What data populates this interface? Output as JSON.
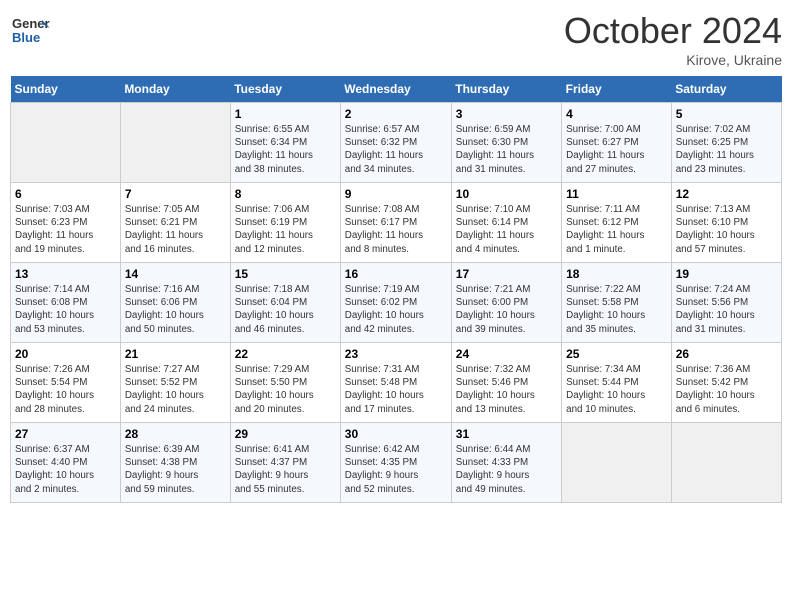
{
  "header": {
    "logo_general": "General",
    "logo_blue": "Blue",
    "month": "October 2024",
    "location": "Kirove, Ukraine"
  },
  "weekdays": [
    "Sunday",
    "Monday",
    "Tuesday",
    "Wednesday",
    "Thursday",
    "Friday",
    "Saturday"
  ],
  "weeks": [
    [
      {
        "day": "",
        "info": ""
      },
      {
        "day": "",
        "info": ""
      },
      {
        "day": "1",
        "info": "Sunrise: 6:55 AM\nSunset: 6:34 PM\nDaylight: 11 hours\nand 38 minutes."
      },
      {
        "day": "2",
        "info": "Sunrise: 6:57 AM\nSunset: 6:32 PM\nDaylight: 11 hours\nand 34 minutes."
      },
      {
        "day": "3",
        "info": "Sunrise: 6:59 AM\nSunset: 6:30 PM\nDaylight: 11 hours\nand 31 minutes."
      },
      {
        "day": "4",
        "info": "Sunrise: 7:00 AM\nSunset: 6:27 PM\nDaylight: 11 hours\nand 27 minutes."
      },
      {
        "day": "5",
        "info": "Sunrise: 7:02 AM\nSunset: 6:25 PM\nDaylight: 11 hours\nand 23 minutes."
      }
    ],
    [
      {
        "day": "6",
        "info": "Sunrise: 7:03 AM\nSunset: 6:23 PM\nDaylight: 11 hours\nand 19 minutes."
      },
      {
        "day": "7",
        "info": "Sunrise: 7:05 AM\nSunset: 6:21 PM\nDaylight: 11 hours\nand 16 minutes."
      },
      {
        "day": "8",
        "info": "Sunrise: 7:06 AM\nSunset: 6:19 PM\nDaylight: 11 hours\nand 12 minutes."
      },
      {
        "day": "9",
        "info": "Sunrise: 7:08 AM\nSunset: 6:17 PM\nDaylight: 11 hours\nand 8 minutes."
      },
      {
        "day": "10",
        "info": "Sunrise: 7:10 AM\nSunset: 6:14 PM\nDaylight: 11 hours\nand 4 minutes."
      },
      {
        "day": "11",
        "info": "Sunrise: 7:11 AM\nSunset: 6:12 PM\nDaylight: 11 hours\nand 1 minute."
      },
      {
        "day": "12",
        "info": "Sunrise: 7:13 AM\nSunset: 6:10 PM\nDaylight: 10 hours\nand 57 minutes."
      }
    ],
    [
      {
        "day": "13",
        "info": "Sunrise: 7:14 AM\nSunset: 6:08 PM\nDaylight: 10 hours\nand 53 minutes."
      },
      {
        "day": "14",
        "info": "Sunrise: 7:16 AM\nSunset: 6:06 PM\nDaylight: 10 hours\nand 50 minutes."
      },
      {
        "day": "15",
        "info": "Sunrise: 7:18 AM\nSunset: 6:04 PM\nDaylight: 10 hours\nand 46 minutes."
      },
      {
        "day": "16",
        "info": "Sunrise: 7:19 AM\nSunset: 6:02 PM\nDaylight: 10 hours\nand 42 minutes."
      },
      {
        "day": "17",
        "info": "Sunrise: 7:21 AM\nSunset: 6:00 PM\nDaylight: 10 hours\nand 39 minutes."
      },
      {
        "day": "18",
        "info": "Sunrise: 7:22 AM\nSunset: 5:58 PM\nDaylight: 10 hours\nand 35 minutes."
      },
      {
        "day": "19",
        "info": "Sunrise: 7:24 AM\nSunset: 5:56 PM\nDaylight: 10 hours\nand 31 minutes."
      }
    ],
    [
      {
        "day": "20",
        "info": "Sunrise: 7:26 AM\nSunset: 5:54 PM\nDaylight: 10 hours\nand 28 minutes."
      },
      {
        "day": "21",
        "info": "Sunrise: 7:27 AM\nSunset: 5:52 PM\nDaylight: 10 hours\nand 24 minutes."
      },
      {
        "day": "22",
        "info": "Sunrise: 7:29 AM\nSunset: 5:50 PM\nDaylight: 10 hours\nand 20 minutes."
      },
      {
        "day": "23",
        "info": "Sunrise: 7:31 AM\nSunset: 5:48 PM\nDaylight: 10 hours\nand 17 minutes."
      },
      {
        "day": "24",
        "info": "Sunrise: 7:32 AM\nSunset: 5:46 PM\nDaylight: 10 hours\nand 13 minutes."
      },
      {
        "day": "25",
        "info": "Sunrise: 7:34 AM\nSunset: 5:44 PM\nDaylight: 10 hours\nand 10 minutes."
      },
      {
        "day": "26",
        "info": "Sunrise: 7:36 AM\nSunset: 5:42 PM\nDaylight: 10 hours\nand 6 minutes."
      }
    ],
    [
      {
        "day": "27",
        "info": "Sunrise: 6:37 AM\nSunset: 4:40 PM\nDaylight: 10 hours\nand 2 minutes."
      },
      {
        "day": "28",
        "info": "Sunrise: 6:39 AM\nSunset: 4:38 PM\nDaylight: 9 hours\nand 59 minutes."
      },
      {
        "day": "29",
        "info": "Sunrise: 6:41 AM\nSunset: 4:37 PM\nDaylight: 9 hours\nand 55 minutes."
      },
      {
        "day": "30",
        "info": "Sunrise: 6:42 AM\nSunset: 4:35 PM\nDaylight: 9 hours\nand 52 minutes."
      },
      {
        "day": "31",
        "info": "Sunrise: 6:44 AM\nSunset: 4:33 PM\nDaylight: 9 hours\nand 49 minutes."
      },
      {
        "day": "",
        "info": ""
      },
      {
        "day": "",
        "info": ""
      }
    ]
  ]
}
